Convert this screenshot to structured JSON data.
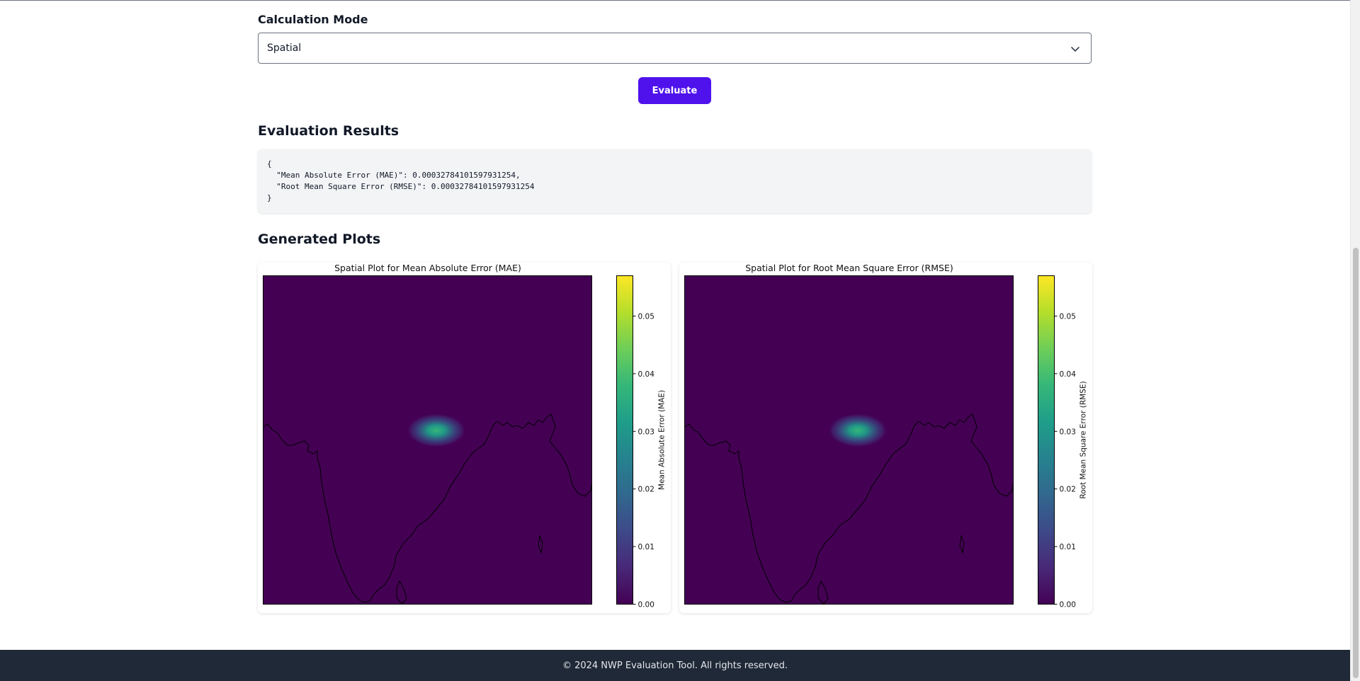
{
  "form": {
    "mode_label": "Calculation Mode",
    "mode_value": "Spatial",
    "evaluate_label": "Evaluate"
  },
  "results": {
    "heading": "Evaluation Results",
    "json_text": "{\n  \"Mean Absolute Error (MAE)\": 0.00032784101597931254,\n  \"Root Mean Square Error (RMSE)\": 0.00032784101597931254\n}"
  },
  "plots": {
    "heading": "Generated Plots",
    "items": [
      {
        "title": "Spatial Plot for Mean Absolute Error (MAE)",
        "colorbar_label": "Mean Absolute Error (MAE)"
      },
      {
        "title": "Spatial Plot for Root Mean Square Error (RMSE)",
        "colorbar_label": "Root Mean Square Error (RMSE)"
      }
    ]
  },
  "chart_data": [
    {
      "type": "heatmap",
      "title": "Spatial Plot for Mean Absolute Error (MAE)",
      "colorbar_label": "Mean Absolute Error (MAE)",
      "colormap": "viridis",
      "vmin": 0.0,
      "vmax": 0.057,
      "colorbar_ticks": [
        0.0,
        0.01,
        0.02,
        0.03,
        0.04,
        0.05
      ],
      "colorbar_tick_labels": [
        "0.00",
        "0.01",
        "0.02",
        "0.03",
        "0.04",
        "0.05"
      ],
      "background_value": 0.0,
      "hotspot_peak": 0.033,
      "hotspot_location": "north-central, above coastline"
    },
    {
      "type": "heatmap",
      "title": "Spatial Plot for Root Mean Square Error (RMSE)",
      "colorbar_label": "Root Mean Square Error (RMSE)",
      "colormap": "viridis",
      "vmin": 0.0,
      "vmax": 0.057,
      "colorbar_ticks": [
        0.0,
        0.01,
        0.02,
        0.03,
        0.04,
        0.05
      ],
      "colorbar_tick_labels": [
        "0.00",
        "0.01",
        "0.02",
        "0.03",
        "0.04",
        "0.05"
      ],
      "background_value": 0.0,
      "hotspot_peak": 0.033,
      "hotspot_location": "north-central, above coastline"
    }
  ],
  "footer": {
    "text": "© 2024 NWP Evaluation Tool. All rights reserved."
  }
}
